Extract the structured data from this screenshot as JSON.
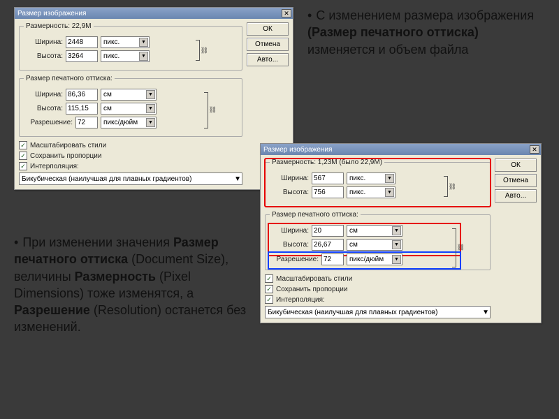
{
  "text1": {
    "pre": "С изменением размера изображения ",
    "bold": "(Размер печатного оттиска)",
    "post": " изменяется и объем файла"
  },
  "text2": {
    "pre": "При изменении значения ",
    "b1": "Размер печатного оттиска",
    "m1": " (Document Size), величины ",
    "b2": "Размерность",
    "m2": " (Pixel Dimensions) тоже изменятся, а ",
    "b3": "Разрешение",
    "m3": " (Resolution) останется без изменений."
  },
  "dlg1": {
    "title": "Размер изображения",
    "fs1_legend": "Размерность:   22,9M",
    "width_label": "Ширина:",
    "width_val": "2448",
    "height_label": "Высота:",
    "height_val": "3264",
    "unit_px": "пикс.",
    "fs2_legend": "Размер печатного оттиска:",
    "width2_val": "86,36",
    "height2_val": "115,15",
    "unit_cm": "см",
    "res_label": "Разрешение:",
    "res_val": "72",
    "unit_res": "пикс/дюйм",
    "chk1": "Масштабировать стили",
    "chk2": "Сохранить пропорции",
    "chk3": "Интерполяция:",
    "method": "Бикубическая (наилучшая для плавных градиентов)",
    "ok": "ОК",
    "cancel": "Отмена",
    "auto": "Авто..."
  },
  "dlg2": {
    "title": "Размер изображения",
    "fs1_legend": "Размерность:   1,23M (было 22,9M)",
    "width_label": "Ширина:",
    "width_val": "567",
    "height_label": "Высота:",
    "height_val": "756",
    "unit_px": "пикс.",
    "fs2_legend": "Размер печатного оттиска:",
    "width2_val": "20",
    "height2_val": "26,67",
    "unit_cm": "см",
    "res_label": "Разрешение:",
    "res_val": "72",
    "unit_res": "пикс/дюйм",
    "chk1": "Масштабировать стили",
    "chk2": "Сохранить пропорции",
    "chk3": "Интерполяция:",
    "method": "Бикубическая (наилучшая для плавных градиентов)",
    "ok": "ОК",
    "cancel": "Отмена",
    "auto": "Авто..."
  }
}
